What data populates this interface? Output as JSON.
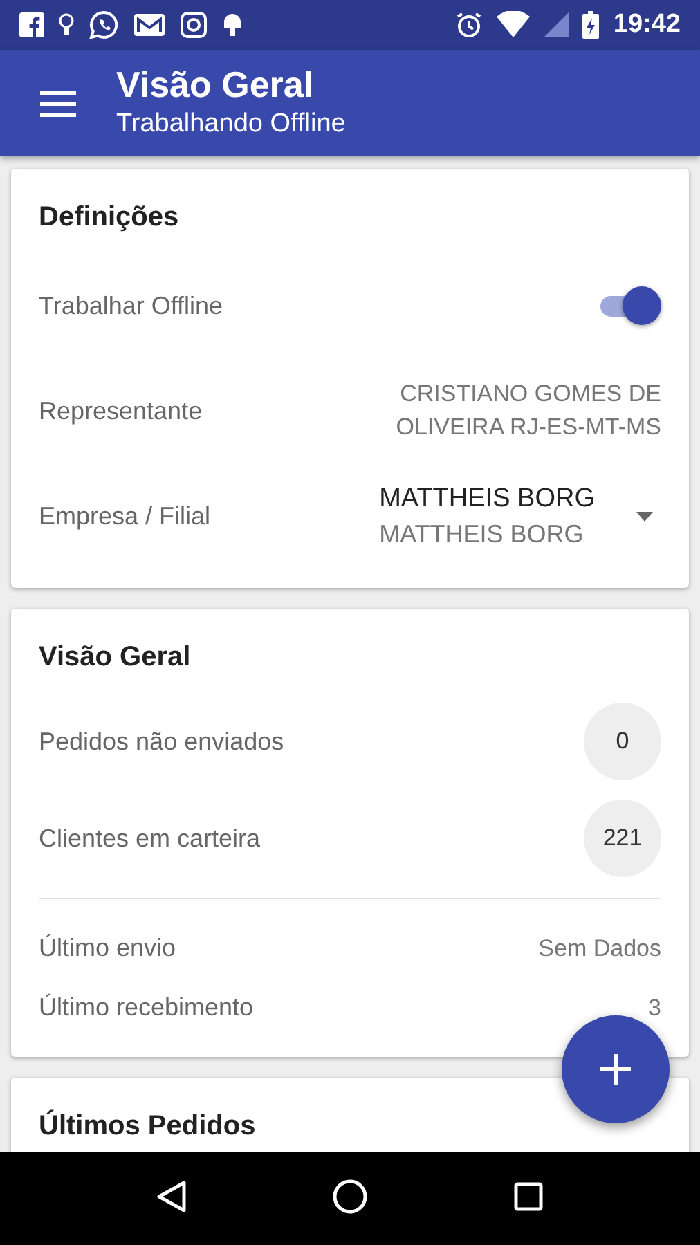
{
  "status_bar": {
    "time": "19:42"
  },
  "app_bar": {
    "title": "Visão Geral",
    "subtitle": "Trabalhando Offline"
  },
  "settings_card": {
    "title": "Definições",
    "rows": [
      {
        "kind": "switch",
        "label": "Trabalhar Offline",
        "on": true
      },
      {
        "kind": "text",
        "label": "Representante",
        "value": "CRISTIANO GOMES DE OLIVEIRA  RJ-ES-MT-MS"
      },
      {
        "kind": "dropdown",
        "label": "Empresa / Filial",
        "value": "MATTHEIS BORG",
        "secondary": "MATTHEIS BORG"
      }
    ]
  },
  "overview_card": {
    "title": "Visão Geral",
    "counters": [
      {
        "label": "Pedidos não enviados",
        "count": "0"
      },
      {
        "label": "Clientes em carteira",
        "count": "221"
      }
    ],
    "info": [
      {
        "label": "Último envio",
        "value": "Sem Dados"
      },
      {
        "label": "Último recebimento",
        "value": "3"
      }
    ]
  },
  "orders_card": {
    "title": "Últimos Pedidos"
  }
}
